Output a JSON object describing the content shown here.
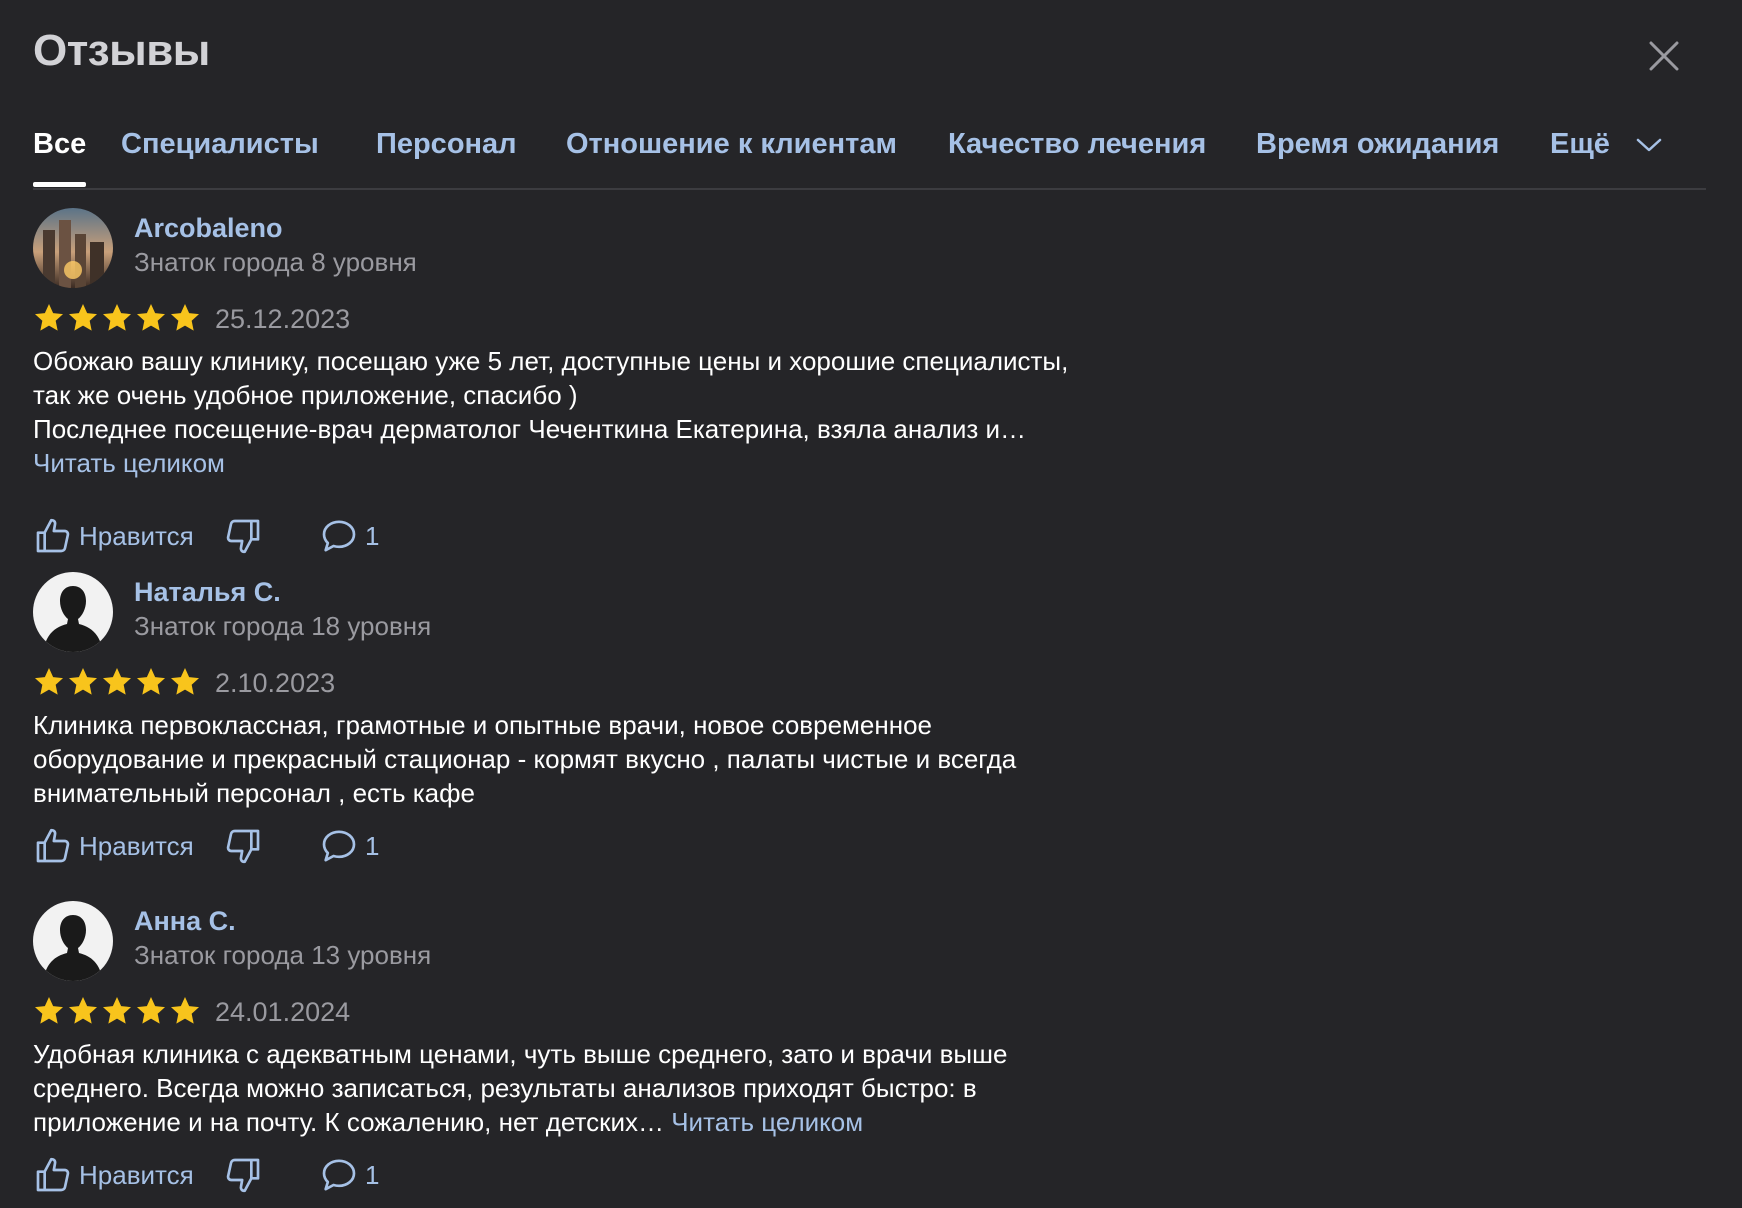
{
  "header": {
    "title": "Отзывы",
    "close_icon": "close-icon"
  },
  "tabs": [
    {
      "label": "Все",
      "active": true
    },
    {
      "label": "Специалисты"
    },
    {
      "label": "Персонал"
    },
    {
      "label": "Отношение к клиентам"
    },
    {
      "label": "Качество лечения"
    },
    {
      "label": "Время ожидания"
    },
    {
      "label": "Ещё",
      "icon": "chevron-down-icon"
    }
  ],
  "colors": {
    "background": "#252528",
    "accent": "#a6c1e6",
    "star": "#f8c41c",
    "muted": "#9a9aa0"
  },
  "reviews": [
    {
      "author": "Arcobaleno",
      "level": "Знаток города 8 уровня",
      "rating": 5,
      "date": "25.12.2023",
      "text_lines": [
        "Обожаю вашу клинику, посещаю уже 5 лет, доступные цены и хорошие специалисты,",
        "так же очень удобное приложение, спасибо )",
        "Последнее посещение-врач дерматолог Чеченткина Екатерина, взяла анализ и…"
      ],
      "read_more": "Читать целиком",
      "like_label": "Нравится",
      "comments_count": "1"
    },
    {
      "author": "Наталья С.",
      "level": "Знаток города 18 уровня",
      "rating": 5,
      "date": "2.10.2023",
      "text_lines": [
        "Клиника первоклассная, грамотные и опытные врачи, новое современное",
        "оборудование и прекрасный стационар - кормят вкусно , палаты чистые и всегда",
        "внимательный персонал , есть кафе"
      ],
      "read_more": "",
      "like_label": "Нравится",
      "comments_count": "1"
    },
    {
      "author": "Анна С.",
      "level": "Знаток города 13 уровня",
      "rating": 5,
      "date": "24.01.2024",
      "text_lines": [
        "Удобная клиника с адекватным ценами, чуть выше среднего, зато и врачи выше",
        "среднего. Всегда можно записаться, результаты анализов приходят быстро: в",
        "приложение и на почту. К сожалению, нет детских…"
      ],
      "read_more": "Читать целиком",
      "like_label": "Нравится",
      "comments_count": "1"
    }
  ]
}
